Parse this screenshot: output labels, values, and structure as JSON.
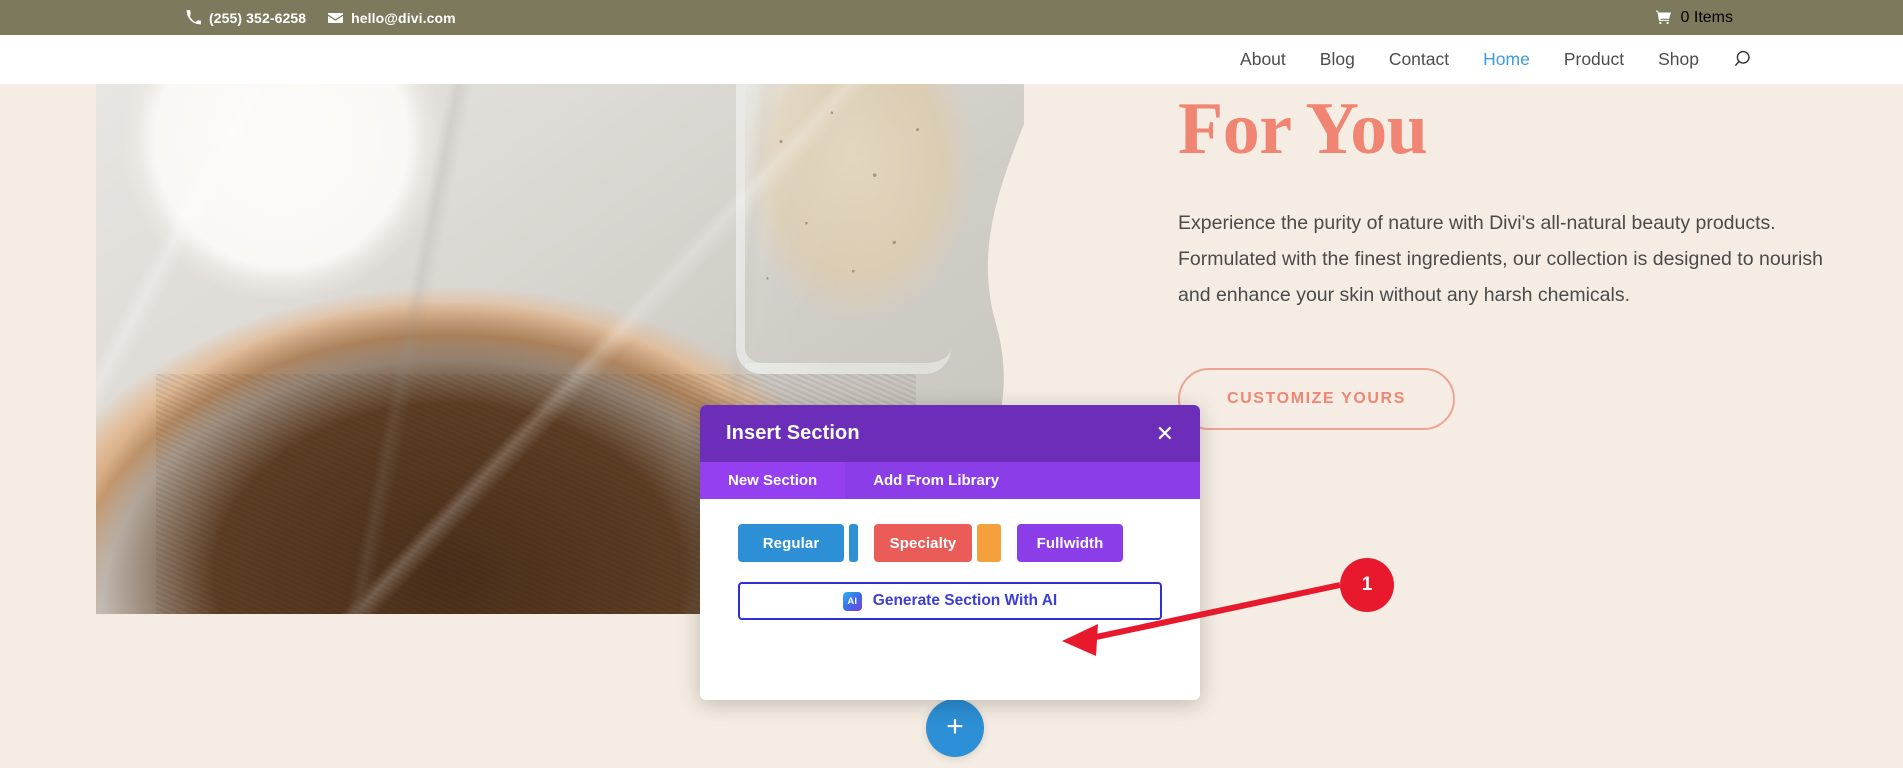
{
  "topbar": {
    "phone": {
      "icon": "phone-icon",
      "text": "(255) 352-6258"
    },
    "email": {
      "icon": "envelope-icon",
      "text": "hello@divi.com"
    },
    "cart": {
      "icon": "shopping-cart-icon",
      "text": "0 Items"
    },
    "background_color": "#7D795C"
  },
  "nav": {
    "items": [
      {
        "label": "About",
        "active": false
      },
      {
        "label": "Blog",
        "active": false
      },
      {
        "label": "Contact",
        "active": false
      },
      {
        "label": "Home",
        "active": true
      },
      {
        "label": "Product",
        "active": false
      },
      {
        "label": "Shop",
        "active": false
      }
    ],
    "search_icon": "search-icon",
    "active_color": "#3E9BE8",
    "link_color": "#4C4C4C"
  },
  "hero": {
    "heading": "For You",
    "heading_color": "#F08573",
    "body": "Experience the purity of nature with Divi's all-natural beauty products. Formulated with the finest ingredients, our collection is designed to nourish and enhance your skin without any harsh chemicals.",
    "cta_label": "CUSTOMIZE YOURS",
    "cta_color": "#F08573",
    "background_color": "#F5EDE3"
  },
  "add_section_button": {
    "icon": "plus-icon",
    "glyph": "+",
    "color": "#2D8FD5"
  },
  "modal": {
    "title": "Insert Section",
    "close_icon": "close-icon",
    "close_glyph": "✕",
    "header_color": "#6C2EB9",
    "tabs": [
      {
        "label": "New Section",
        "active": true
      },
      {
        "label": "Add From Library",
        "active": false
      }
    ],
    "section_types": [
      {
        "label": "Regular",
        "color": "#2D8FD5",
        "accent": "#2D8FD5"
      },
      {
        "label": "Specialty",
        "color": "#E95C58",
        "accent": "#F4A13C"
      },
      {
        "label": "Fullwidth",
        "color": "#8B3DE8",
        "accent": null
      }
    ],
    "ai_button": {
      "label": "Generate Section With AI",
      "badge_icon": "ai-badge-icon",
      "badge_text": "AI",
      "border_color": "#2E30D6",
      "text_color": "#3B3DD6"
    }
  },
  "annotation": {
    "number": "1",
    "color": "#E8192C",
    "arrow_icon": "arrow-left-icon",
    "points_to": "Generate Section With AI"
  }
}
